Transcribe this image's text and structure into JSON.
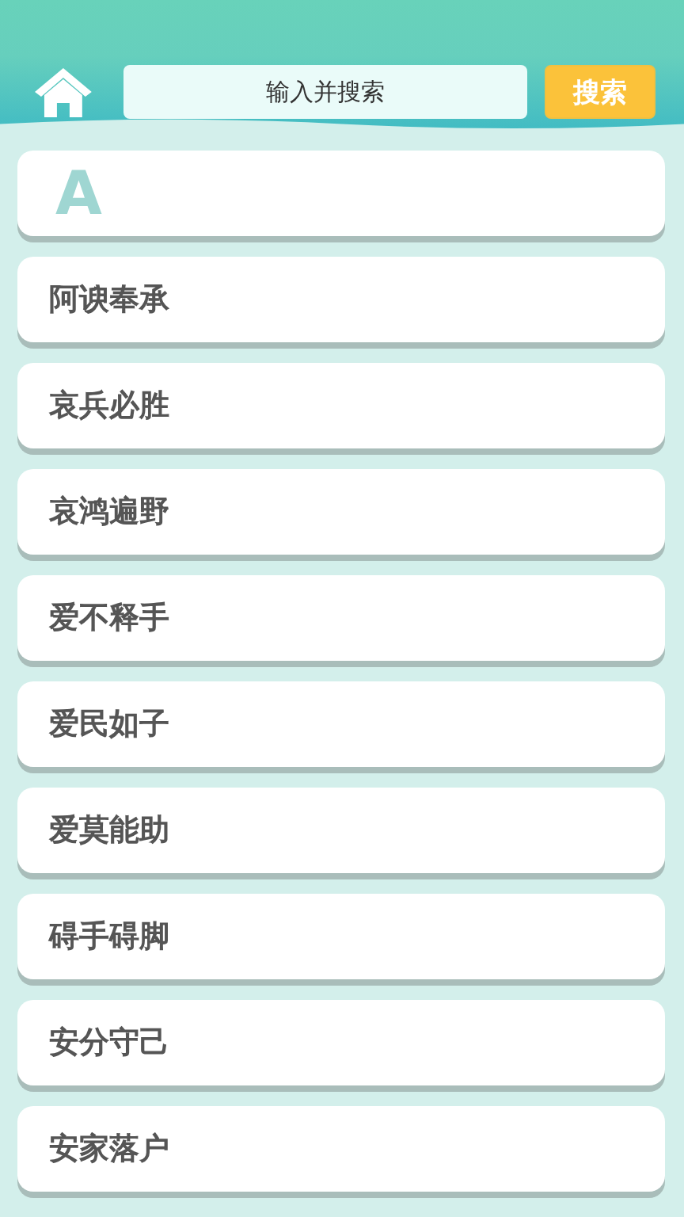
{
  "search": {
    "placeholder": "输入并搜索",
    "button": "搜索"
  },
  "section": {
    "letter": "A"
  },
  "items": [
    "阿谀奉承",
    "哀兵必胜",
    "哀鸿遍野",
    "爱不释手",
    "爱民如子",
    "爱莫能助",
    "碍手碍脚",
    "安分守己",
    "安家落户"
  ]
}
